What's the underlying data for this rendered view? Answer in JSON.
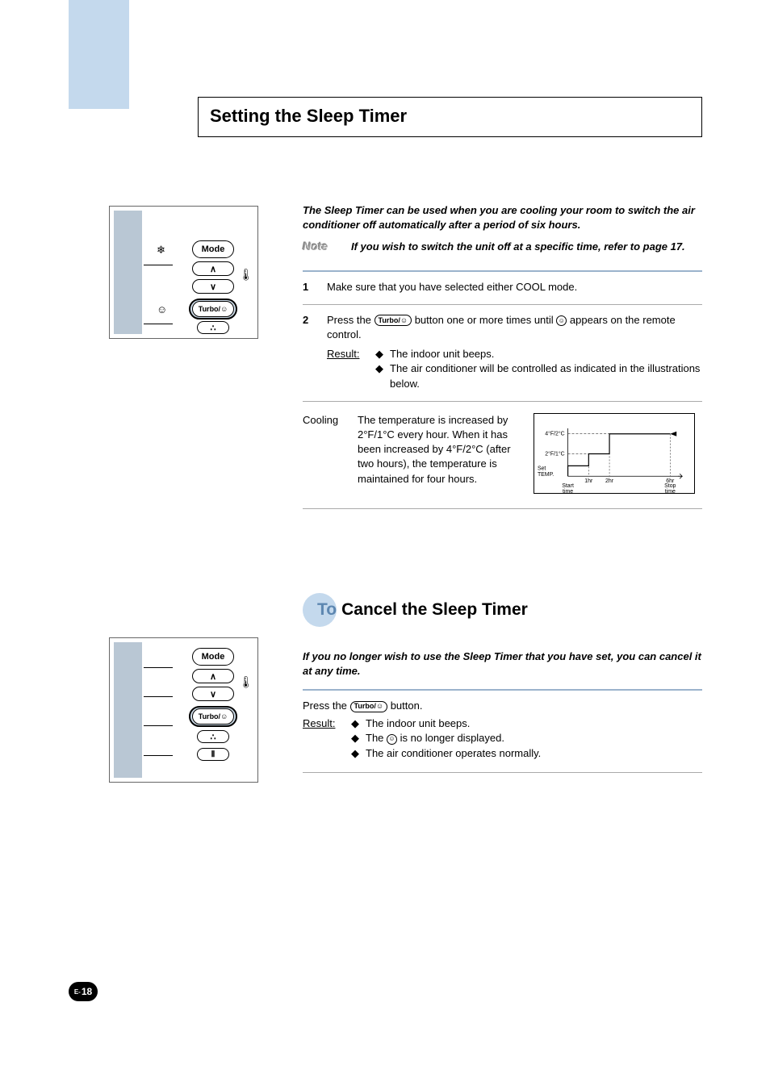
{
  "title": "Setting the Sleep Timer",
  "intro": "The Sleep Timer can be used when you are cooling your room to switch the air conditioner off automatically after a period of six hours.",
  "note_label": "Note",
  "note_text": "If you wish to switch the unit off at a specific time, refer to page 17.",
  "step1": {
    "num": "1",
    "text": "Make sure that you have selected either COOL mode."
  },
  "step2": {
    "num": "2",
    "text_before": "Press the ",
    "text_mid": " button one or more times until ",
    "text_after": " appears on the remote control.",
    "result_label": "Result:",
    "bullets": [
      "The indoor unit beeps.",
      "The air conditioner will be controlled as indicated in the illustrations below."
    ]
  },
  "cooling": {
    "label": "Cooling",
    "text": "The temperature is increased by 2°F/1°C every hour. When it has been increased by 4°F/2°C (after two hours), the temperature is maintained for four hours."
  },
  "cancel_heading": {
    "to": "To",
    "rest": "Cancel the Sleep Timer"
  },
  "cancel_intro": "If you no longer wish to use the Sleep Timer that you have set, you can cancel it at any time.",
  "cancel_step": {
    "text_before": "Press the ",
    "text_after": " button.",
    "result_label": "Result:",
    "bullets_before": "The ",
    "bullets_after": " is no longer displayed.",
    "bullets": [
      "The indoor unit beeps.",
      null,
      "The air conditioner operates normally."
    ]
  },
  "remote_labels": {
    "mode": "Mode",
    "turbo": "Turbo/"
  },
  "page_num": {
    "prefix": "E-",
    "num": "18"
  },
  "chart_data": {
    "type": "line",
    "title": "",
    "xlabel": "",
    "ylabel": "Set TEMP.",
    "x_ticks": [
      "Start time",
      "1hr",
      "2hr",
      "6hr"
    ],
    "x_end_label": "Stop time",
    "y_ticks": [
      "2°F/1°C",
      "4°F/2°C"
    ],
    "series": [
      {
        "name": "temp",
        "x": [
          0,
          1,
          2,
          6
        ],
        "y": [
          0,
          1,
          2,
          2
        ]
      }
    ],
    "xlim": [
      0,
      6
    ],
    "ylim": [
      0,
      2
    ]
  }
}
